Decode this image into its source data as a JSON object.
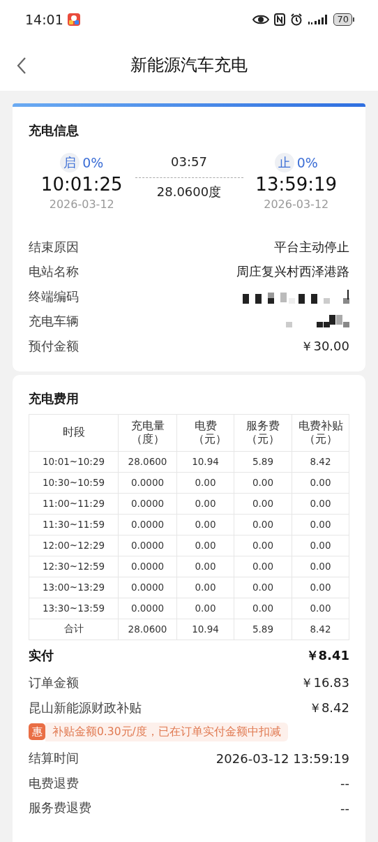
{
  "status_bar": {
    "time": "14:01",
    "battery": "70"
  },
  "header": {
    "title": "新能源汽车充电"
  },
  "charge_info": {
    "title": "充电信息",
    "start": {
      "badge": "启",
      "soc": "0%",
      "time": "10:01:25",
      "date": "2026-03-12"
    },
    "duration": "03:57",
    "energy": "28.0600度",
    "end": {
      "badge": "止",
      "soc": "0%",
      "time": "13:59:19",
      "date": "2026-03-12"
    },
    "rows": [
      {
        "label": "结束原因",
        "kind": "text",
        "value": "平台主动停止"
      },
      {
        "label": "电站名称",
        "kind": "text",
        "value": "周庄复兴村西泽港路"
      },
      {
        "label": "终端编码",
        "kind": "redacted"
      },
      {
        "label": "充电车辆",
        "kind": "redacted"
      },
      {
        "label": "预付金额",
        "kind": "text",
        "value": "￥30.00"
      }
    ]
  },
  "fees": {
    "title": "充电费用",
    "table": {
      "columns": [
        "时段",
        "充电量（度）",
        "电费（元）",
        "服务费（元）",
        "电费补贴（元）"
      ],
      "rows": [
        [
          "10:01~10:29",
          "28.0600",
          "10.94",
          "5.89",
          "8.42"
        ],
        [
          "10:30~10:59",
          "0.0000",
          "0.00",
          "0.00",
          "0.00"
        ],
        [
          "11:00~11:29",
          "0.0000",
          "0.00",
          "0.00",
          "0.00"
        ],
        [
          "11:30~11:59",
          "0.0000",
          "0.00",
          "0.00",
          "0.00"
        ],
        [
          "12:00~12:29",
          "0.0000",
          "0.00",
          "0.00",
          "0.00"
        ],
        [
          "12:30~12:59",
          "0.0000",
          "0.00",
          "0.00",
          "0.00"
        ],
        [
          "13:00~13:29",
          "0.0000",
          "0.00",
          "0.00",
          "0.00"
        ],
        [
          "13:30~13:59",
          "0.0000",
          "0.00",
          "0.00",
          "0.00"
        ],
        [
          "合计",
          "28.0600",
          "10.94",
          "5.89",
          "8.42"
        ]
      ]
    },
    "summary": [
      {
        "label": "实付",
        "value": "￥8.41",
        "kind": "total"
      },
      {
        "label": "订单金额",
        "value": "￥16.83",
        "kind": "line"
      },
      {
        "label": "昆山新能源财政补贴",
        "value": "￥8.42",
        "kind": "line"
      },
      {
        "kind": "notice",
        "badge": "惠",
        "text": "补贴金额0.30元/度，已在订单实付金额中扣减"
      },
      {
        "label": "结算时间",
        "value": "2026-03-12 13:59:19",
        "kind": "line"
      },
      {
        "label": "电费退费",
        "value": "--",
        "kind": "line"
      },
      {
        "label": "服务费退费",
        "value": "--",
        "kind": "line"
      }
    ]
  }
}
